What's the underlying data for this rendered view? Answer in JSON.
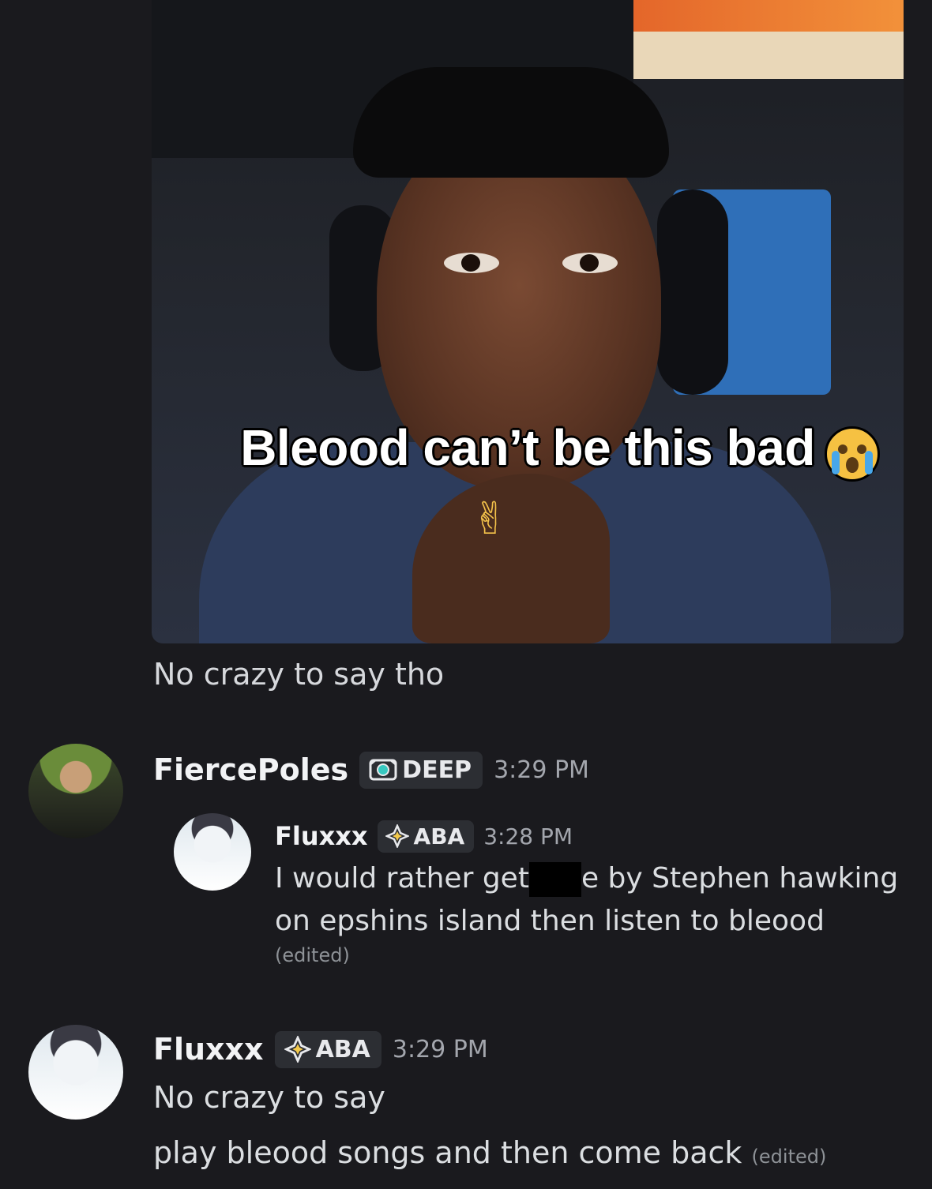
{
  "media": {
    "caption": "Bleood can’t be this bad",
    "caption_emoji": "loudly-crying-face-emoji",
    "peace_emoji": "✌"
  },
  "text_below_media": "No crazy to say tho",
  "messages": [
    {
      "author": "FiercePoles",
      "tag": "DEEP",
      "tag_icon": "badge-icon",
      "time": "3:29 PM",
      "quote": {
        "author": "Fluxxx",
        "tag": "ABA",
        "tag_icon": "diamond-sparkle-icon",
        "time": "3:28 PM",
        "line1_a": "I would rather get",
        "line1_b": "e by Stephen hawking",
        "line2": "on epshins island then listen to bleood",
        "edited": "(edited)"
      }
    },
    {
      "author": "Fluxxx",
      "tag": "ABA",
      "tag_icon": "diamond-sparkle-icon",
      "time": "3:29 PM",
      "line1": "No crazy to say",
      "line2": "play bleood songs and then come back",
      "edited": "(edited)"
    }
  ]
}
